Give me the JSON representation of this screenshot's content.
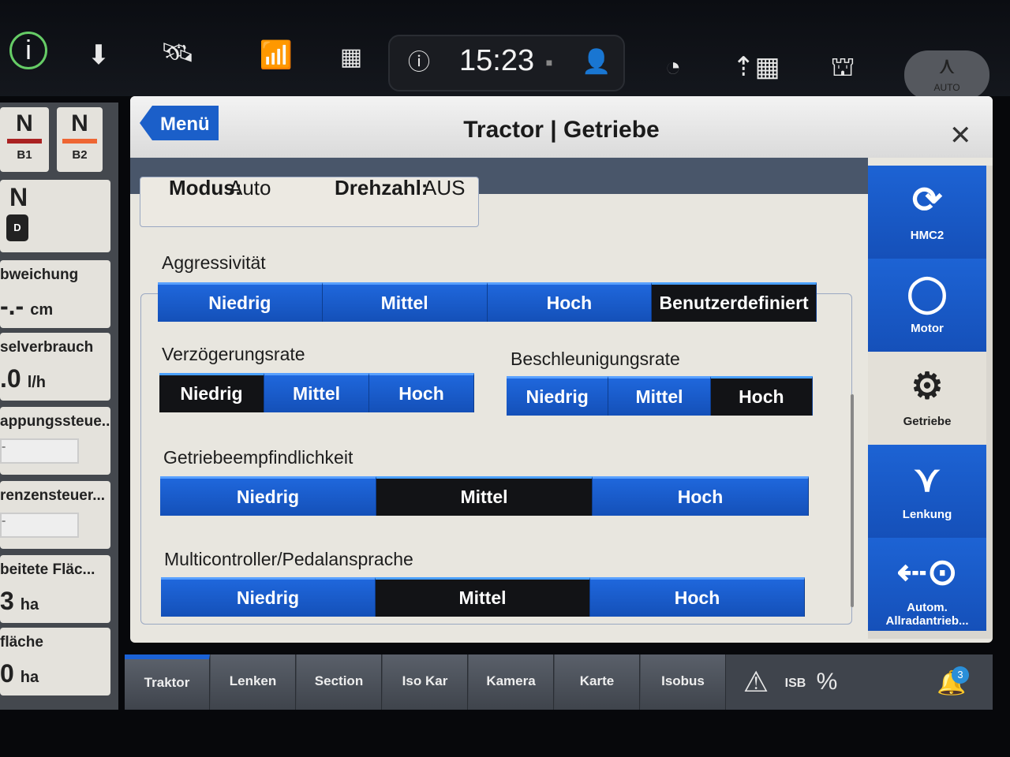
{
  "topbar": {
    "time": "15:23",
    "auto_label": "AUTO",
    "icons": [
      "info-icon",
      "download-icon",
      "satellite-icon",
      "wifi-signal-icon",
      "apps-grid-icon",
      "help-icon",
      "camera-icon",
      "user-icon",
      "speedometer-icon",
      "implement-icon",
      "field-icon",
      "auto-steer-icon"
    ]
  },
  "left_panel": {
    "b1": {
      "gear": "N",
      "label": "B1"
    },
    "b2": {
      "gear": "N",
      "label": "B2"
    },
    "drive": {
      "gear": "N",
      "mode": "D"
    },
    "tiles": [
      {
        "label": "bweichung",
        "value": "-.-",
        "unit": "cm"
      },
      {
        "label": "selverbrauch",
        "value": ".0",
        "unit": "l/h"
      },
      {
        "label": "appungssteue...",
        "value": "-"
      },
      {
        "label": "renzensteuer...",
        "value": "-"
      },
      {
        "label": "beitete Fläc...",
        "value": "3",
        "unit": "ha"
      },
      {
        "label": "fläche",
        "value": "0",
        "unit": "ha"
      }
    ]
  },
  "dialog": {
    "menu_label": "Menü",
    "title": "Tractor | Getriebe",
    "mode": {
      "label": "Modus:",
      "value": "Auto"
    },
    "rpm": {
      "label": "Drehzahl:",
      "value": "AUS"
    },
    "groups": [
      {
        "label": "Aggressivität",
        "options": [
          "Niedrig",
          "Mittel",
          "Hoch",
          "Benutzerdefiniert"
        ],
        "selected": "Benutzerdefiniert"
      },
      {
        "label": "Verzögerungsrate",
        "options": [
          "Niedrig",
          "Mittel",
          "Hoch"
        ],
        "selected": "Niedrig"
      },
      {
        "label": "Beschleunigungsrate",
        "options": [
          "Niedrig",
          "Mittel",
          "Hoch"
        ],
        "selected": "Hoch"
      },
      {
        "label": "Getriebeempfindlichkeit",
        "options": [
          "Niedrig",
          "Mittel",
          "Hoch"
        ],
        "selected": "Mittel"
      },
      {
        "label": "Multicontroller/Pedalansprache",
        "options": [
          "Niedrig",
          "Mittel",
          "Hoch"
        ],
        "selected": "Mittel"
      }
    ],
    "sidebar": [
      {
        "label": "HMC2",
        "icon": "hmc2-icon",
        "glyph": "⟳"
      },
      {
        "label": "Motor",
        "icon": "engine-icon",
        "glyph": "◯"
      },
      {
        "label": "Getriebe",
        "icon": "gear-icon",
        "glyph": "⚙",
        "active": true
      },
      {
        "label": "Lenkung",
        "icon": "steering-icon",
        "glyph": "⋎"
      },
      {
        "label": "Autom. Allradantrieb...",
        "icon": "four-wheel-drive-icon",
        "glyph": "⇠⊙"
      }
    ]
  },
  "bottombar": {
    "tabs": [
      "Traktor",
      "Lenken",
      "Section",
      "Iso Kar",
      "Kamera",
      "Karte",
      "Isobus"
    ],
    "active": "Traktor",
    "notification_count": "3"
  },
  "colors": {
    "accent": "#1b5fc9",
    "selected": "#121316"
  }
}
